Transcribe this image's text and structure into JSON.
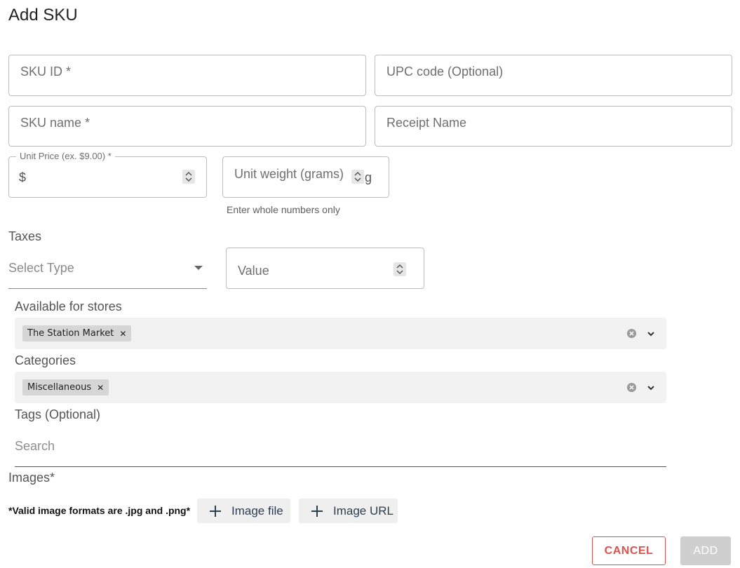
{
  "dialog": {
    "title": "Add SKU"
  },
  "fields": {
    "sku_id": {
      "placeholder": "SKU ID *"
    },
    "upc_code": {
      "placeholder": "UPC code (Optional)"
    },
    "sku_name": {
      "placeholder": "SKU name *"
    },
    "receipt_name": {
      "placeholder": "Receipt Name"
    },
    "unit_price": {
      "label": "Unit Price (ex. $9.00) *",
      "prefix": "$"
    },
    "unit_weight": {
      "placeholder": "Unit weight (grams)",
      "suffix": "g",
      "helper": "Enter whole numbers only"
    }
  },
  "taxes": {
    "label": "Taxes",
    "select_placeholder": "Select Type",
    "value_placeholder": "Value"
  },
  "stores": {
    "label": "Available for stores",
    "chips": [
      "The Station Market"
    ]
  },
  "categories": {
    "label": "Categories",
    "chips": [
      "Miscellaneous"
    ]
  },
  "tags": {
    "label": "Tags (Optional)",
    "search_placeholder": "Search"
  },
  "images": {
    "label": "Images*",
    "note": "*Valid image formats are .jpg and .png*",
    "file_button": "Image file",
    "url_button": "Image URL"
  },
  "actions": {
    "cancel": "CANCEL",
    "add": "ADD"
  },
  "colors": {
    "cancel": "#d9534f",
    "add_disabled": "#cfcfcf",
    "chip": "#d6d6d6",
    "multi_bg": "#f2f2f2",
    "image_button_text": "#2d3e50"
  },
  "icons": {
    "spinner": "up-down-spinner-icon",
    "clear": "clear-circle-icon",
    "dropdown": "chevron-down-icon",
    "select_caret": "caret-down-icon",
    "chip_remove": "close-icon",
    "add": "plus-icon"
  }
}
